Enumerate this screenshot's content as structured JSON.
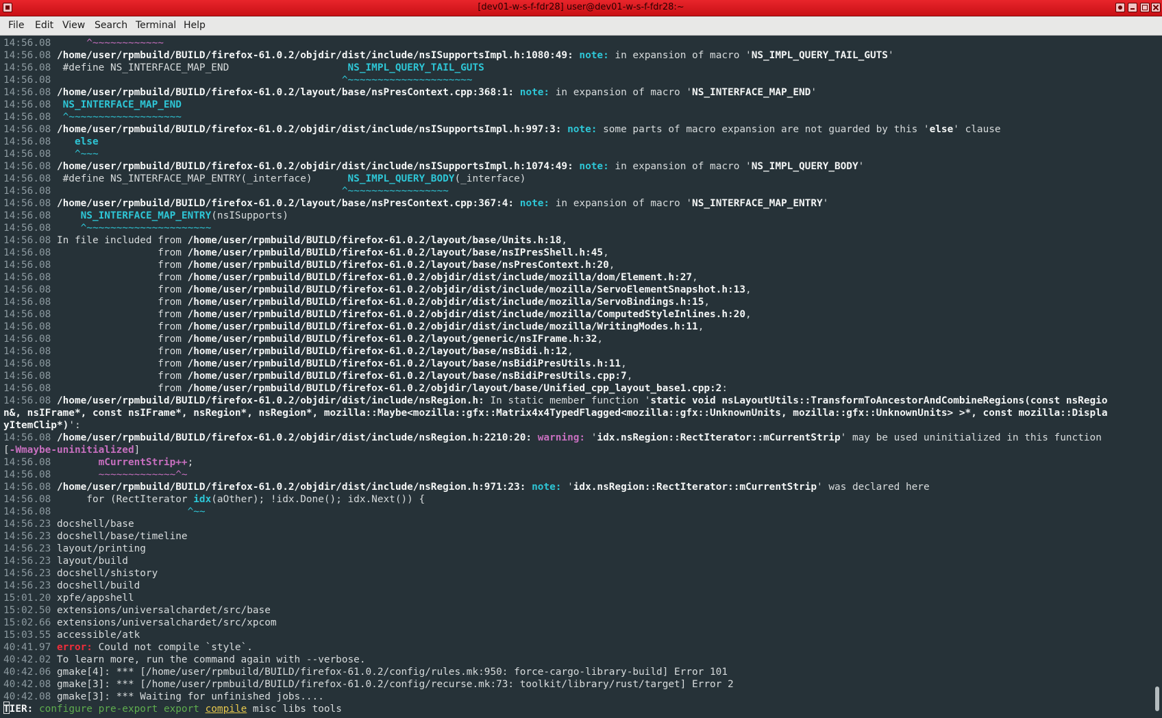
{
  "window": {
    "title": "[dev01-w-s-f-fdr28] user@dev01-w-s-f-fdr28:~"
  },
  "menu": {
    "items": [
      "File",
      "Edit",
      "View",
      "Search",
      "Terminal",
      "Help"
    ]
  },
  "terminal": {
    "lines": [
      {
        "ts": "14:56.08",
        "spans": [
          [
            "",
            "      "
          ],
          [
            "mag",
            "^~~~~~~~~~~~~"
          ]
        ]
      },
      {
        "ts": "14:56.08",
        "spans": [
          [
            "b",
            " /home/user/rpmbuild/BUILD/firefox-61.0.2/objdir/dist/include/nsISupportsImpl.h:1080:49:"
          ],
          [
            "",
            " "
          ],
          [
            "note",
            "note:"
          ],
          [
            "",
            " in expansion of macro '"
          ],
          [
            "b",
            "NS_IMPL_QUERY_TAIL_GUTS"
          ],
          [
            "",
            "'"
          ]
        ]
      },
      {
        "ts": "14:56.08",
        "spans": [
          [
            "",
            "  #define NS_INTERFACE_MAP_END                    "
          ],
          [
            "cyanb",
            "NS_IMPL_QUERY_TAIL_GUTS"
          ]
        ]
      },
      {
        "ts": "14:56.08",
        "spans": [
          [
            "",
            "                                                 "
          ],
          [
            "cyan",
            "^~~~~~~~~~~~~~~~~~~~~~"
          ]
        ]
      },
      {
        "ts": "14:56.08",
        "spans": [
          [
            "b",
            " /home/user/rpmbuild/BUILD/firefox-61.0.2/layout/base/nsPresContext.cpp:368:1:"
          ],
          [
            "",
            " "
          ],
          [
            "note",
            "note:"
          ],
          [
            "",
            " in expansion of macro '"
          ],
          [
            "b",
            "NS_INTERFACE_MAP_END"
          ],
          [
            "",
            "'"
          ]
        ]
      },
      {
        "ts": "14:56.08",
        "spans": [
          [
            "",
            "  "
          ],
          [
            "cyanb",
            "NS_INTERFACE_MAP_END"
          ]
        ]
      },
      {
        "ts": "14:56.08",
        "spans": [
          [
            "",
            "  "
          ],
          [
            "cyan",
            "^~~~~~~~~~~~~~~~~~~~"
          ]
        ]
      },
      {
        "ts": "14:56.08",
        "spans": [
          [
            "b",
            " /home/user/rpmbuild/BUILD/firefox-61.0.2/objdir/dist/include/nsISupportsImpl.h:997:3:"
          ],
          [
            "",
            " "
          ],
          [
            "note",
            "note:"
          ],
          [
            "",
            " some parts of macro expansion are not guarded by this '"
          ],
          [
            "b",
            "else"
          ],
          [
            "",
            "' clause"
          ]
        ]
      },
      {
        "ts": "14:56.08",
        "spans": [
          [
            "",
            "    "
          ],
          [
            "cyanb",
            "else"
          ]
        ]
      },
      {
        "ts": "14:56.08",
        "spans": [
          [
            "",
            "    "
          ],
          [
            "cyan",
            "^~~~"
          ]
        ]
      },
      {
        "ts": "14:56.08",
        "spans": [
          [
            "b",
            " /home/user/rpmbuild/BUILD/firefox-61.0.2/objdir/dist/include/nsISupportsImpl.h:1074:49:"
          ],
          [
            "",
            " "
          ],
          [
            "note",
            "note:"
          ],
          [
            "",
            " in expansion of macro '"
          ],
          [
            "b",
            "NS_IMPL_QUERY_BODY"
          ],
          [
            "",
            "'"
          ]
        ]
      },
      {
        "ts": "14:56.08",
        "spans": [
          [
            "",
            "  #define NS_INTERFACE_MAP_ENTRY(_interface)      "
          ],
          [
            "cyanb",
            "NS_IMPL_QUERY_BODY"
          ],
          [
            "",
            "(_interface)"
          ]
        ]
      },
      {
        "ts": "14:56.08",
        "spans": [
          [
            "",
            "                                                 "
          ],
          [
            "cyan",
            "^~~~~~~~~~~~~~~~~~"
          ]
        ]
      },
      {
        "ts": "14:56.08",
        "spans": [
          [
            "b",
            " /home/user/rpmbuild/BUILD/firefox-61.0.2/layout/base/nsPresContext.cpp:367:4:"
          ],
          [
            "",
            " "
          ],
          [
            "note",
            "note:"
          ],
          [
            "",
            " in expansion of macro '"
          ],
          [
            "b",
            "NS_INTERFACE_MAP_ENTRY"
          ],
          [
            "",
            "'"
          ]
        ]
      },
      {
        "ts": "14:56.08",
        "spans": [
          [
            "",
            "     "
          ],
          [
            "cyanb",
            "NS_INTERFACE_MAP_ENTRY"
          ],
          [
            "",
            "(nsISupports)"
          ]
        ]
      },
      {
        "ts": "14:56.08",
        "spans": [
          [
            "",
            "     "
          ],
          [
            "cyan",
            "^~~~~~~~~~~~~~~~~~~~~~"
          ]
        ]
      },
      {
        "ts": "14:56.08",
        "spans": [
          [
            "",
            " In file included from "
          ],
          [
            "b",
            "/home/user/rpmbuild/BUILD/firefox-61.0.2/layout/base/Units.h:18"
          ],
          [
            "",
            ","
          ]
        ]
      },
      {
        "ts": "14:56.08",
        "spans": [
          [
            "",
            "                  from "
          ],
          [
            "b",
            "/home/user/rpmbuild/BUILD/firefox-61.0.2/layout/base/nsIPresShell.h:45"
          ],
          [
            "",
            ","
          ]
        ]
      },
      {
        "ts": "14:56.08",
        "spans": [
          [
            "",
            "                  from "
          ],
          [
            "b",
            "/home/user/rpmbuild/BUILD/firefox-61.0.2/layout/base/nsPresContext.h:20"
          ],
          [
            "",
            ","
          ]
        ]
      },
      {
        "ts": "14:56.08",
        "spans": [
          [
            "",
            "                  from "
          ],
          [
            "b",
            "/home/user/rpmbuild/BUILD/firefox-61.0.2/objdir/dist/include/mozilla/dom/Element.h:27"
          ],
          [
            "",
            ","
          ]
        ]
      },
      {
        "ts": "14:56.08",
        "spans": [
          [
            "",
            "                  from "
          ],
          [
            "b",
            "/home/user/rpmbuild/BUILD/firefox-61.0.2/objdir/dist/include/mozilla/ServoElementSnapshot.h:13"
          ],
          [
            "",
            ","
          ]
        ]
      },
      {
        "ts": "14:56.08",
        "spans": [
          [
            "",
            "                  from "
          ],
          [
            "b",
            "/home/user/rpmbuild/BUILD/firefox-61.0.2/objdir/dist/include/mozilla/ServoBindings.h:15"
          ],
          [
            "",
            ","
          ]
        ]
      },
      {
        "ts": "14:56.08",
        "spans": [
          [
            "",
            "                  from "
          ],
          [
            "b",
            "/home/user/rpmbuild/BUILD/firefox-61.0.2/objdir/dist/include/mozilla/ComputedStyleInlines.h:20"
          ],
          [
            "",
            ","
          ]
        ]
      },
      {
        "ts": "14:56.08",
        "spans": [
          [
            "",
            "                  from "
          ],
          [
            "b",
            "/home/user/rpmbuild/BUILD/firefox-61.0.2/objdir/dist/include/mozilla/WritingModes.h:11"
          ],
          [
            "",
            ","
          ]
        ]
      },
      {
        "ts": "14:56.08",
        "spans": [
          [
            "",
            "                  from "
          ],
          [
            "b",
            "/home/user/rpmbuild/BUILD/firefox-61.0.2/layout/generic/nsIFrame.h:32"
          ],
          [
            "",
            ","
          ]
        ]
      },
      {
        "ts": "14:56.08",
        "spans": [
          [
            "",
            "                  from "
          ],
          [
            "b",
            "/home/user/rpmbuild/BUILD/firefox-61.0.2/layout/base/nsBidi.h:12"
          ],
          [
            "",
            ","
          ]
        ]
      },
      {
        "ts": "14:56.08",
        "spans": [
          [
            "",
            "                  from "
          ],
          [
            "b",
            "/home/user/rpmbuild/BUILD/firefox-61.0.2/layout/base/nsBidiPresUtils.h:11"
          ],
          [
            "",
            ","
          ]
        ]
      },
      {
        "ts": "14:56.08",
        "spans": [
          [
            "",
            "                  from "
          ],
          [
            "b",
            "/home/user/rpmbuild/BUILD/firefox-61.0.2/layout/base/nsBidiPresUtils.cpp:7"
          ],
          [
            "",
            ","
          ]
        ]
      },
      {
        "ts": "14:56.08",
        "spans": [
          [
            "",
            "                  from "
          ],
          [
            "b",
            "/home/user/rpmbuild/BUILD/firefox-61.0.2/objdir/layout/base/Unified_cpp_layout_base1.cpp:2"
          ],
          [
            "",
            ":"
          ]
        ]
      },
      {
        "ts": "14:56.08",
        "spans": [
          [
            "b",
            " /home/user/rpmbuild/BUILD/firefox-61.0.2/objdir/dist/include/nsRegion.h:"
          ],
          [
            "",
            " In static member function '"
          ],
          [
            "b",
            "static void nsLayoutUtils::TransformToAncestorAndCombineRegions(const nsRegio"
          ]
        ]
      },
      {
        "ts": "",
        "spans": [
          [
            "b",
            "n&, nsIFrame*, const nsIFrame*, nsRegion*, nsRegion*, mozilla::Maybe<mozilla::gfx::Matrix4x4TypedFlagged<mozilla::gfx::UnknownUnits, mozilla::gfx::UnknownUnits> >*, const mozilla::Displa"
          ]
        ]
      },
      {
        "ts": "",
        "spans": [
          [
            "b",
            "yItemClip*)"
          ],
          [
            "",
            "':"
          ]
        ]
      },
      {
        "ts": "14:56.08",
        "spans": [
          [
            "b",
            " /home/user/rpmbuild/BUILD/firefox-61.0.2/objdir/dist/include/nsRegion.h:2210:20:"
          ],
          [
            "",
            " "
          ],
          [
            "magb",
            "warning:"
          ],
          [
            "",
            " '"
          ],
          [
            "b",
            "idx.nsRegion::RectIterator::mCurrentStrip"
          ],
          [
            "",
            "' may be used uninitialized in this function"
          ]
        ]
      },
      {
        "ts": "",
        "spans": [
          [
            "",
            "["
          ],
          [
            "magb",
            "-Wmaybe-uninitialized"
          ],
          [
            "",
            "]"
          ]
        ]
      },
      {
        "ts": "14:56.08",
        "spans": [
          [
            "",
            "        "
          ],
          [
            "magb",
            "mCurrentStrip++"
          ],
          [
            "",
            ";"
          ]
        ]
      },
      {
        "ts": "14:56.08",
        "spans": [
          [
            "",
            "        "
          ],
          [
            "mag",
            "~~~~~~~~~~~~~^~"
          ]
        ]
      },
      {
        "ts": "14:56.08",
        "spans": [
          [
            "b",
            " /home/user/rpmbuild/BUILD/firefox-61.0.2/objdir/dist/include/nsRegion.h:971:23:"
          ],
          [
            "",
            " "
          ],
          [
            "note",
            "note:"
          ],
          [
            "",
            " '"
          ],
          [
            "b",
            "idx.nsRegion::RectIterator::mCurrentStrip"
          ],
          [
            "",
            "' was declared here"
          ]
        ]
      },
      {
        "ts": "14:56.08",
        "spans": [
          [
            "",
            "      for (RectIterator "
          ],
          [
            "cyanb",
            "idx"
          ],
          [
            "",
            "(aOther); !idx.Done(); idx.Next()) {"
          ]
        ]
      },
      {
        "ts": "14:56.08",
        "spans": [
          [
            "",
            "                       "
          ],
          [
            "cyan",
            "^~~"
          ]
        ]
      },
      {
        "ts": "14:56.23",
        "spans": [
          [
            "",
            " docshell/base"
          ]
        ]
      },
      {
        "ts": "14:56.23",
        "spans": [
          [
            "",
            " docshell/base/timeline"
          ]
        ]
      },
      {
        "ts": "14:56.23",
        "spans": [
          [
            "",
            " layout/printing"
          ]
        ]
      },
      {
        "ts": "14:56.23",
        "spans": [
          [
            "",
            " layout/build"
          ]
        ]
      },
      {
        "ts": "14:56.23",
        "spans": [
          [
            "",
            " docshell/shistory"
          ]
        ]
      },
      {
        "ts": "14:56.23",
        "spans": [
          [
            "",
            " docshell/build"
          ]
        ]
      },
      {
        "ts": "15:01.20",
        "spans": [
          [
            "",
            " xpfe/appshell"
          ]
        ]
      },
      {
        "ts": "15:02.50",
        "spans": [
          [
            "",
            " extensions/universalchardet/src/base"
          ]
        ]
      },
      {
        "ts": "15:02.66",
        "spans": [
          [
            "",
            " extensions/universalchardet/src/xpcom"
          ]
        ]
      },
      {
        "ts": "15:03.55",
        "spans": [
          [
            "",
            " accessible/atk"
          ]
        ]
      },
      {
        "ts": "40:41.97",
        "spans": [
          [
            "",
            " "
          ],
          [
            "err",
            "error:"
          ],
          [
            "",
            " Could not compile `style`."
          ]
        ]
      },
      {
        "ts": "40:42.02",
        "spans": [
          [
            "",
            " To learn more, run the command again with --verbose."
          ]
        ]
      },
      {
        "ts": "40:42.06",
        "spans": [
          [
            "",
            " gmake[4]: *** [/home/user/rpmbuild/BUILD/firefox-61.0.2/config/rules.mk:950: force-cargo-library-build] Error 101"
          ]
        ]
      },
      {
        "ts": "40:42.08",
        "spans": [
          [
            "",
            " gmake[3]: *** [/home/user/rpmbuild/BUILD/firefox-61.0.2/config/recurse.mk:73: toolkit/library/rust/target] Error 2"
          ]
        ]
      },
      {
        "ts": "40:42.08",
        "spans": [
          [
            "",
            " gmake[3]: *** Waiting for unfinished jobs...."
          ]
        ]
      },
      {
        "ts": "",
        "spans": [
          [
            "b",
            "TIER:"
          ],
          [
            "",
            " "
          ],
          [
            "green",
            "configure pre-export export"
          ],
          [
            "",
            " "
          ],
          [
            "hl",
            "compile"
          ],
          [
            "",
            " misc libs tools"
          ]
        ]
      }
    ]
  }
}
